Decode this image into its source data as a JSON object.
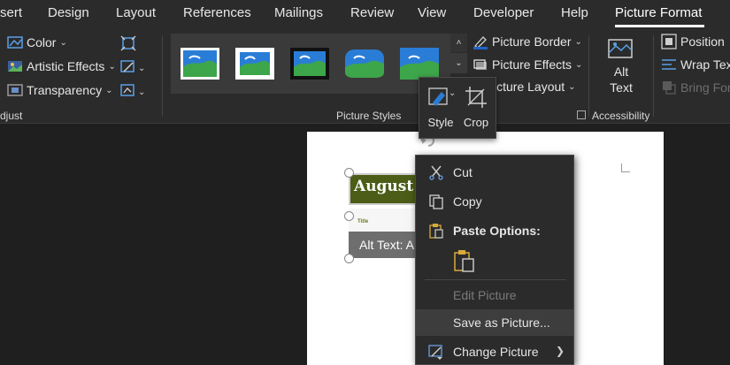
{
  "tabs": [
    {
      "label": "sert"
    },
    {
      "label": "Design"
    },
    {
      "label": "Layout"
    },
    {
      "label": "References"
    },
    {
      "label": "Mailings"
    },
    {
      "label": "Review"
    },
    {
      "label": "View"
    },
    {
      "label": "Developer"
    },
    {
      "label": "Help"
    },
    {
      "label": "Picture Format",
      "active": true
    }
  ],
  "adjust": {
    "color_label": "Color",
    "artistic_label": "Artistic Effects",
    "transparency_label": "Transparency",
    "group_label": "djust"
  },
  "picture_styles": {
    "group_label": "Picture Styles",
    "border_label": "Picture Border",
    "effects_label": "Picture Effects",
    "layout_label": "Picture Layout",
    "layout_label_visible": "icture Layout"
  },
  "accessibility": {
    "alt_text_line1": "Alt",
    "alt_text_line2": "Text",
    "group_label": "Accessibility"
  },
  "arrange": {
    "position_label": "Position",
    "wrap_label": "Wrap Text",
    "bring_label": "Bring Forw"
  },
  "mini_toolbar": {
    "style_label": "Style",
    "crop_label": "Crop"
  },
  "document": {
    "picture_title": "August",
    "picture_subtitle": "Title",
    "alt_text_overlay": "Alt Text: A"
  },
  "context_menu": {
    "cut": "Cut",
    "copy": "Copy",
    "paste_options": "Paste Options:",
    "edit_picture": "Edit Picture",
    "save_as_picture": "Save as Picture...",
    "change_picture": "Change Picture"
  },
  "colors": {
    "ribbon_bg": "#2b2b2b",
    "canvas_bg": "#1f1f1f",
    "accent_blue": "#1e64c8",
    "accent_green": "#4b5d17"
  }
}
